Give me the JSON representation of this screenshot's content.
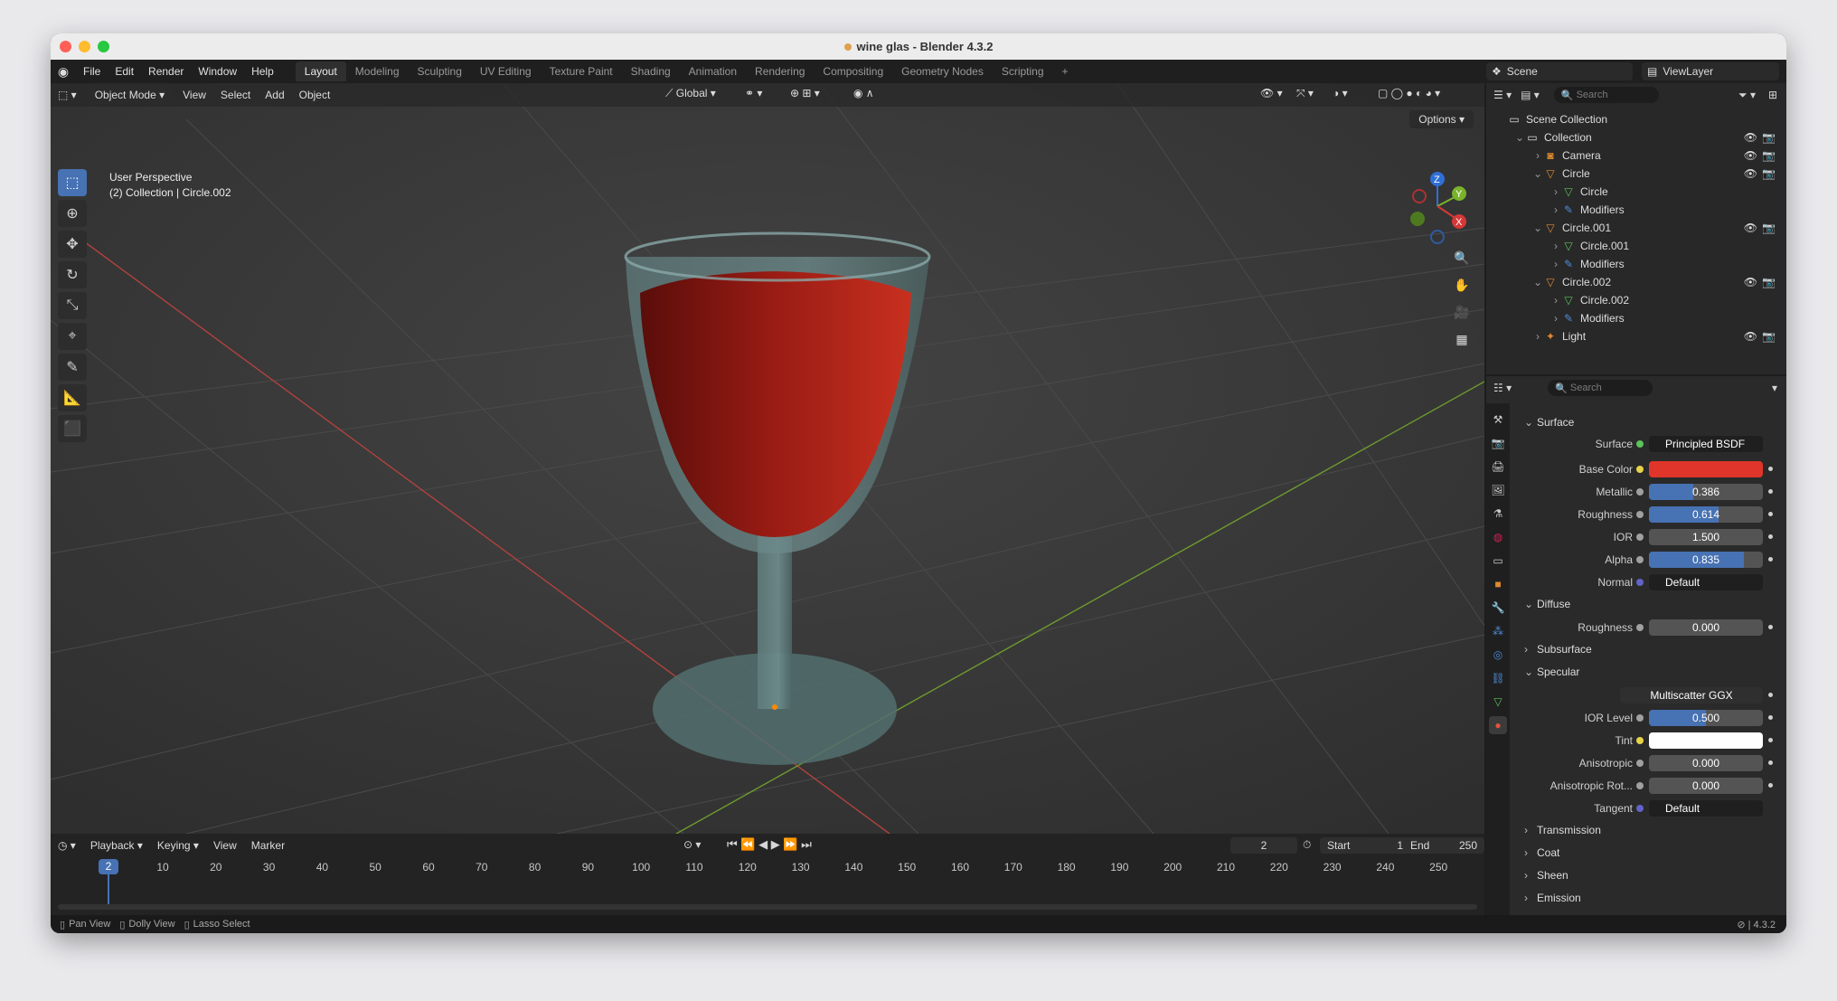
{
  "window": {
    "title": "wine glas - Blender 4.3.2"
  },
  "menu": [
    "File",
    "Edit",
    "Render",
    "Window",
    "Help"
  ],
  "workspaces": [
    "Layout",
    "Modeling",
    "Sculpting",
    "UV Editing",
    "Texture Paint",
    "Shading",
    "Animation",
    "Rendering",
    "Compositing",
    "Geometry Nodes",
    "Scripting",
    "+"
  ],
  "active_workspace": "Layout",
  "scene": "Scene",
  "view_layer": "ViewLayer",
  "viewport": {
    "mode": "Object Mode",
    "menus": [
      "View",
      "Select",
      "Add",
      "Object"
    ],
    "transform_orientation": "Global",
    "options_label": "Options",
    "info_line1": "User Perspective",
    "info_line2": "(2) Collection | Circle.002",
    "gizmo": {
      "z": "Z",
      "y": "Y",
      "x": "X"
    }
  },
  "timeline": {
    "menus": [
      "Playback",
      "Keying",
      "View",
      "Marker"
    ],
    "current_frame": "2",
    "start_label": "Start",
    "start": "1",
    "end_label": "End",
    "end": "250",
    "ruler": [
      "10",
      "20",
      "30",
      "40",
      "50",
      "60",
      "70",
      "80",
      "90",
      "100",
      "110",
      "120",
      "130",
      "140",
      "150",
      "160",
      "170",
      "180",
      "190",
      "200",
      "210",
      "220",
      "230",
      "240",
      "250"
    ]
  },
  "status": {
    "pan": "Pan View",
    "dolly": "Dolly View",
    "lasso": "Lasso Select",
    "version": "4.3.2"
  },
  "outliner": {
    "search_placeholder": "Search",
    "rows": [
      {
        "label": "Scene Collection",
        "indent": 0,
        "icon": "▭",
        "chev": ""
      },
      {
        "label": "Collection",
        "indent": 1,
        "icon": "▭",
        "chev": "⌄"
      },
      {
        "label": "Camera",
        "indent": 2,
        "icon": "◙",
        "chev": "›"
      },
      {
        "label": "Circle",
        "indent": 2,
        "icon": "▽",
        "chev": "⌄"
      },
      {
        "label": "Circle",
        "indent": 3,
        "icon": "▽",
        "chev": "›"
      },
      {
        "label": "Modifiers",
        "indent": 3,
        "icon": "✎",
        "chev": "›"
      },
      {
        "label": "Circle.001",
        "indent": 2,
        "icon": "▽",
        "chev": "⌄"
      },
      {
        "label": "Circle.001",
        "indent": 3,
        "icon": "▽",
        "chev": "›"
      },
      {
        "label": "Modifiers",
        "indent": 3,
        "icon": "✎",
        "chev": "›"
      },
      {
        "label": "Circle.002",
        "indent": 2,
        "icon": "▽",
        "chev": "⌄"
      },
      {
        "label": "Circle.002",
        "indent": 3,
        "icon": "▽",
        "chev": "›"
      },
      {
        "label": "Modifiers",
        "indent": 3,
        "icon": "✎",
        "chev": "›"
      },
      {
        "label": "Light",
        "indent": 2,
        "icon": "✦",
        "chev": "›"
      }
    ]
  },
  "properties": {
    "search_placeholder": "Search",
    "surface_section": "Surface",
    "surface_label": "Surface",
    "surface_value": "Principled BSDF",
    "base_color_label": "Base Color",
    "base_color": "#e0352a",
    "metallic_label": "Metallic",
    "metallic": "0.386",
    "metallic_fill": 0.386,
    "roughness_label": "Roughness",
    "roughness": "0.614",
    "roughness_fill": 0.614,
    "ior_label": "IOR",
    "ior": "1.500",
    "alpha_label": "Alpha",
    "alpha": "0.835",
    "alpha_fill": 0.835,
    "normal_label": "Normal",
    "normal": "Default",
    "diffuse_section": "Diffuse",
    "diffuse_roughness_label": "Roughness",
    "diffuse_roughness": "0.000",
    "subsurface_section": "Subsurface",
    "specular_section": "Specular",
    "distribution": "Multiscatter GGX",
    "ior_level_label": "IOR Level",
    "ior_level": "0.500",
    "ior_level_fill": 0.5,
    "tint_label": "Tint",
    "tint": "#ffffff",
    "anisotropic_label": "Anisotropic",
    "anisotropic": "0.000",
    "anisotropic_rot_label": "Anisotropic Rot...",
    "anisotropic_rot": "0.000",
    "tangent_label": "Tangent",
    "tangent": "Default",
    "transmission_section": "Transmission",
    "coat_section": "Coat",
    "sheen_section": "Sheen",
    "emission_section": "Emission"
  }
}
